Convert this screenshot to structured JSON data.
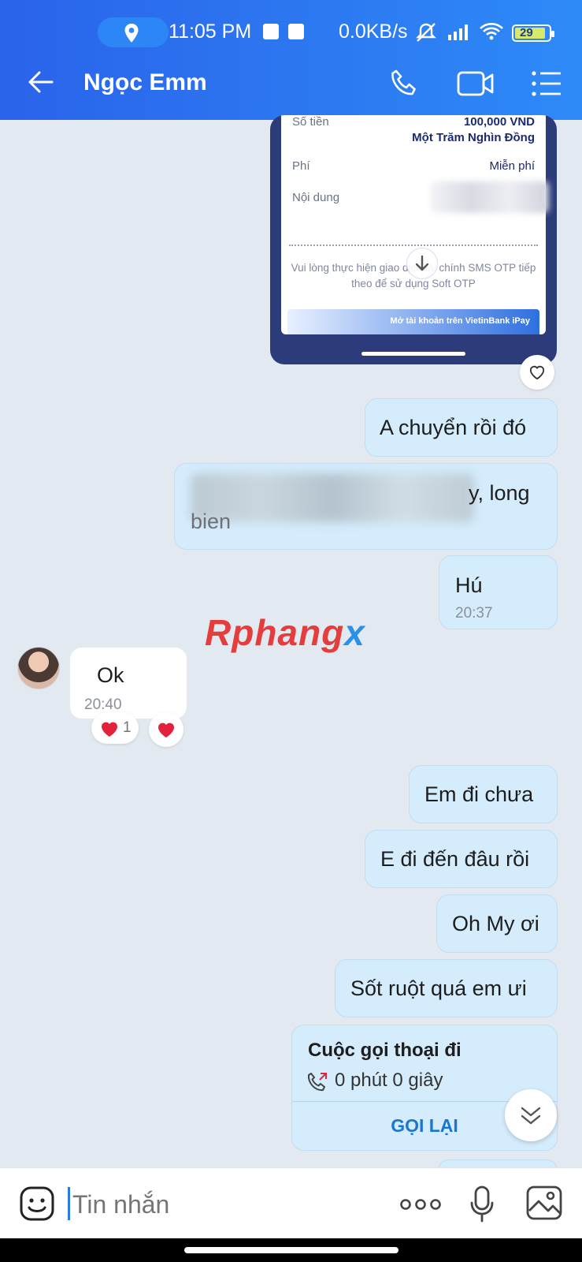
{
  "status_bar": {
    "time": "11:05 PM",
    "network_speed": "0.0KB/s",
    "battery": "29"
  },
  "header": {
    "title": "Ngọc Emm"
  },
  "receipt": {
    "amount_label": "Số tiền",
    "amount_value": "100,000 VND",
    "amount_words": "Một Trăm Nghìn Đồng",
    "fee_label": "Phí",
    "fee_value": "Miễn phí",
    "content_label": "Nội dung",
    "note": "Vui lòng thực hiện giao dịch tài chính SMS OTP tiếp theo để sử dụng Soft OTP",
    "banner": "Mở tài khoản trên VietinBank iPay"
  },
  "messages": [
    {
      "text": "A chuyển rồi đó"
    },
    {
      "text": "y, long",
      "text2": "bien"
    },
    {
      "text": "Hú",
      "time": "20:37"
    },
    {
      "text": "Ok",
      "time": "20:40",
      "reaction_count": "1"
    },
    {
      "text": "Em đi chưa"
    },
    {
      "text": "E đi đến đâu rồi"
    },
    {
      "text": "Oh My ơi"
    },
    {
      "text": "Sốt ruột quá em ưi"
    }
  ],
  "watermark": {
    "part1": "Rphang",
    "part2": "x"
  },
  "call_card": {
    "title": "Cuộc gọi thoại đi",
    "duration": "0 phút 0 giây",
    "action": "GỌI LẠI"
  },
  "input": {
    "placeholder": "Tin nhắn"
  }
}
